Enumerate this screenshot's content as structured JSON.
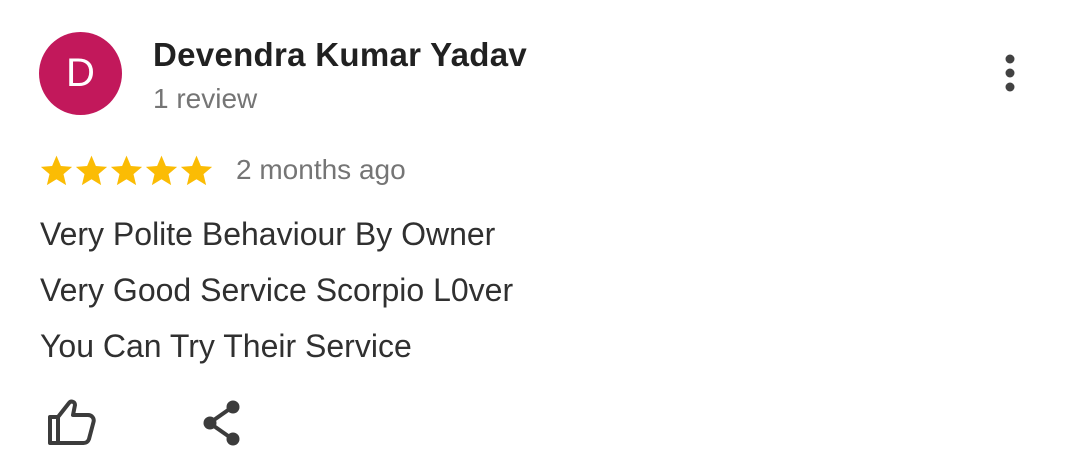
{
  "review": {
    "author": {
      "initial": "D",
      "name": "Devendra Kumar Yadav",
      "review_count": "1 review",
      "avatar_color": "#c2185b"
    },
    "rating": 5,
    "rating_max": 5,
    "star_color": "#fbbc04",
    "time_ago": "2 months ago",
    "body_lines": [
      "Very Polite Behaviour By Owner",
      "Very Good Service Scorpio L0ver",
      "You Can Try Their Service"
    ],
    "actions": {
      "like_icon": "thumbs-up-icon",
      "share_icon": "share-icon",
      "menu_icon": "more-vert-icon"
    }
  }
}
